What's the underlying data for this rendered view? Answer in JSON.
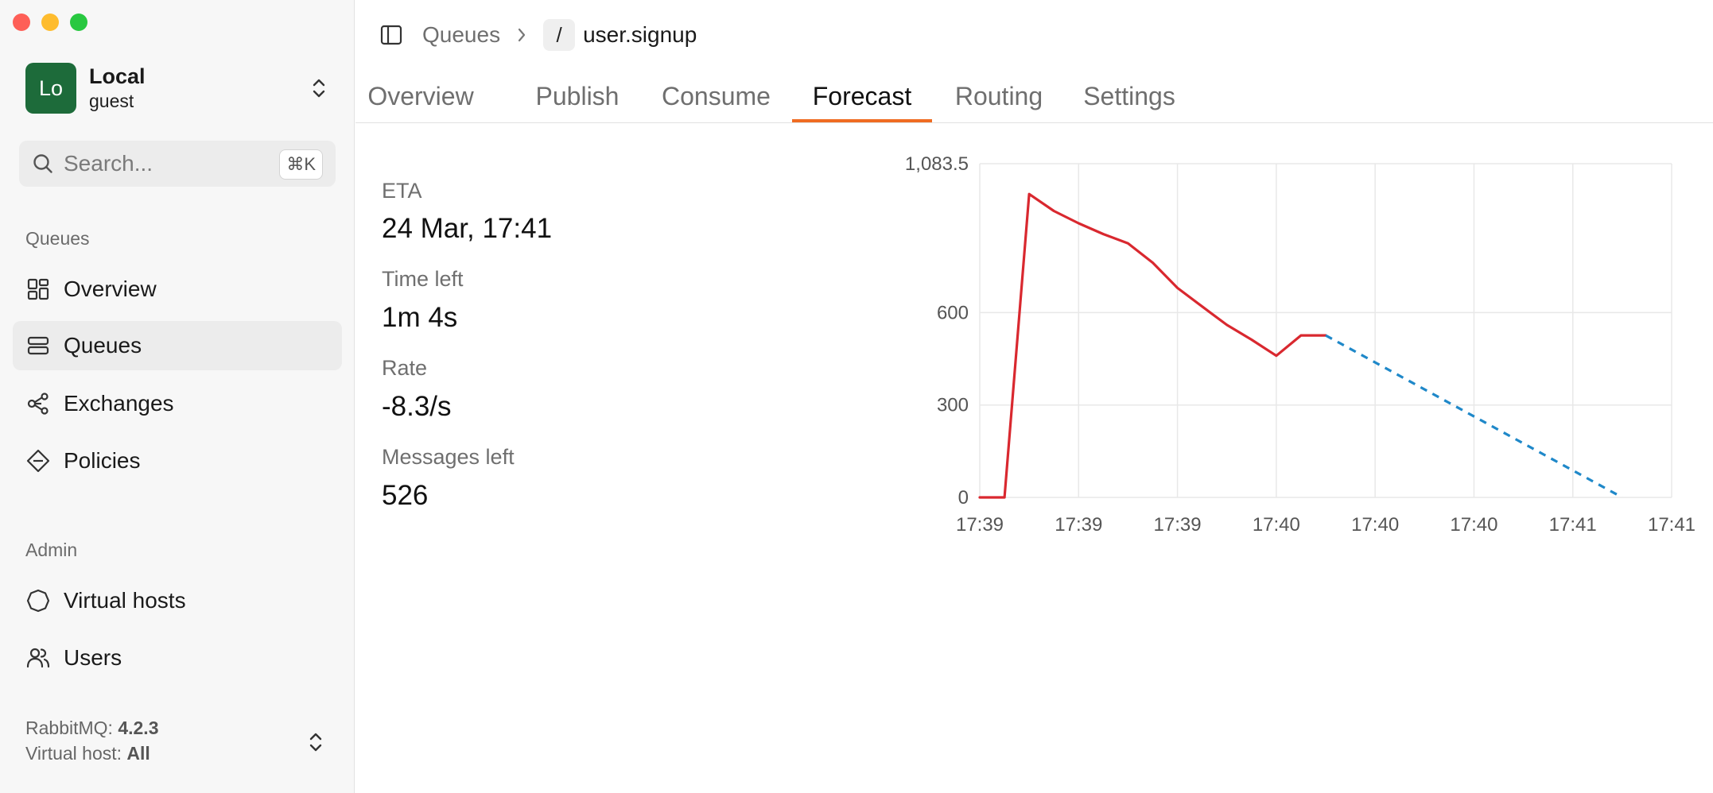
{
  "sidebar": {
    "account": {
      "initials": "Lo",
      "name": "Local",
      "user": "guest"
    },
    "search": {
      "placeholder": "Search...",
      "shortcut": "⌘K"
    },
    "queues_section": "Queues",
    "queues_items": [
      {
        "label": "Overview",
        "icon": "grid-icon"
      },
      {
        "label": "Queues",
        "icon": "queues-icon",
        "active": true
      },
      {
        "label": "Exchanges",
        "icon": "exchanges-icon"
      },
      {
        "label": "Policies",
        "icon": "policies-icon"
      }
    ],
    "admin_section": "Admin",
    "admin_items": [
      {
        "label": "Virtual hosts",
        "icon": "virtual-hosts-icon"
      },
      {
        "label": "Users",
        "icon": "users-icon"
      }
    ],
    "footer": {
      "rabbitmq_label": "RabbitMQ:",
      "rabbitmq_version": "4.2.3",
      "vhost_label": "Virtual host:",
      "vhost_value": "All"
    }
  },
  "breadcrumb": {
    "parent": "Queues",
    "vhost": "/",
    "current": "user.signup"
  },
  "tabs": [
    {
      "label": "Overview"
    },
    {
      "label": "Publish"
    },
    {
      "label": "Consume"
    },
    {
      "label": "Forecast",
      "active": true
    },
    {
      "label": "Routing"
    },
    {
      "label": "Settings"
    }
  ],
  "forecast": {
    "eta_label": "ETA",
    "eta_value": "24 Mar, 17:41",
    "time_left_label": "Time left",
    "time_left_value": "1m 4s",
    "rate_label": "Rate",
    "rate_value": "-8.3/s",
    "messages_left_label": "Messages left",
    "messages_left_value": "526"
  },
  "colors": {
    "accent": "#ef6c22",
    "actual_series": "#d9282f",
    "forecast_series": "#1f88c9",
    "avatar_bg": "#1d6b3a"
  },
  "chart_data": {
    "type": "line",
    "x_tick_labels": [
      "17:39",
      "17:39",
      "17:39",
      "17:40",
      "17:40",
      "17:40",
      "17:41",
      "17:41"
    ],
    "y_tick_labels": [
      "0",
      "300",
      "600",
      "1,083.5"
    ],
    "ylim": [
      0,
      1083.5
    ],
    "xlim": [
      0,
      7
    ],
    "grid": true,
    "series": [
      {
        "style": "solid",
        "color": "#d9282f",
        "x": [
          0,
          0.25,
          0.5,
          0.75,
          1,
          1.25,
          1.5,
          1.75,
          2,
          2.25,
          2.5,
          2.75,
          3,
          3.25,
          3.5
        ],
        "y": [
          0,
          0,
          985,
          930,
          890,
          855,
          825,
          762,
          680,
          620,
          560,
          512,
          460,
          526,
          526
        ]
      },
      {
        "style": "dashed",
        "color": "#1f88c9",
        "x": [
          3.5,
          6.5
        ],
        "y": [
          526,
          0
        ]
      }
    ]
  }
}
